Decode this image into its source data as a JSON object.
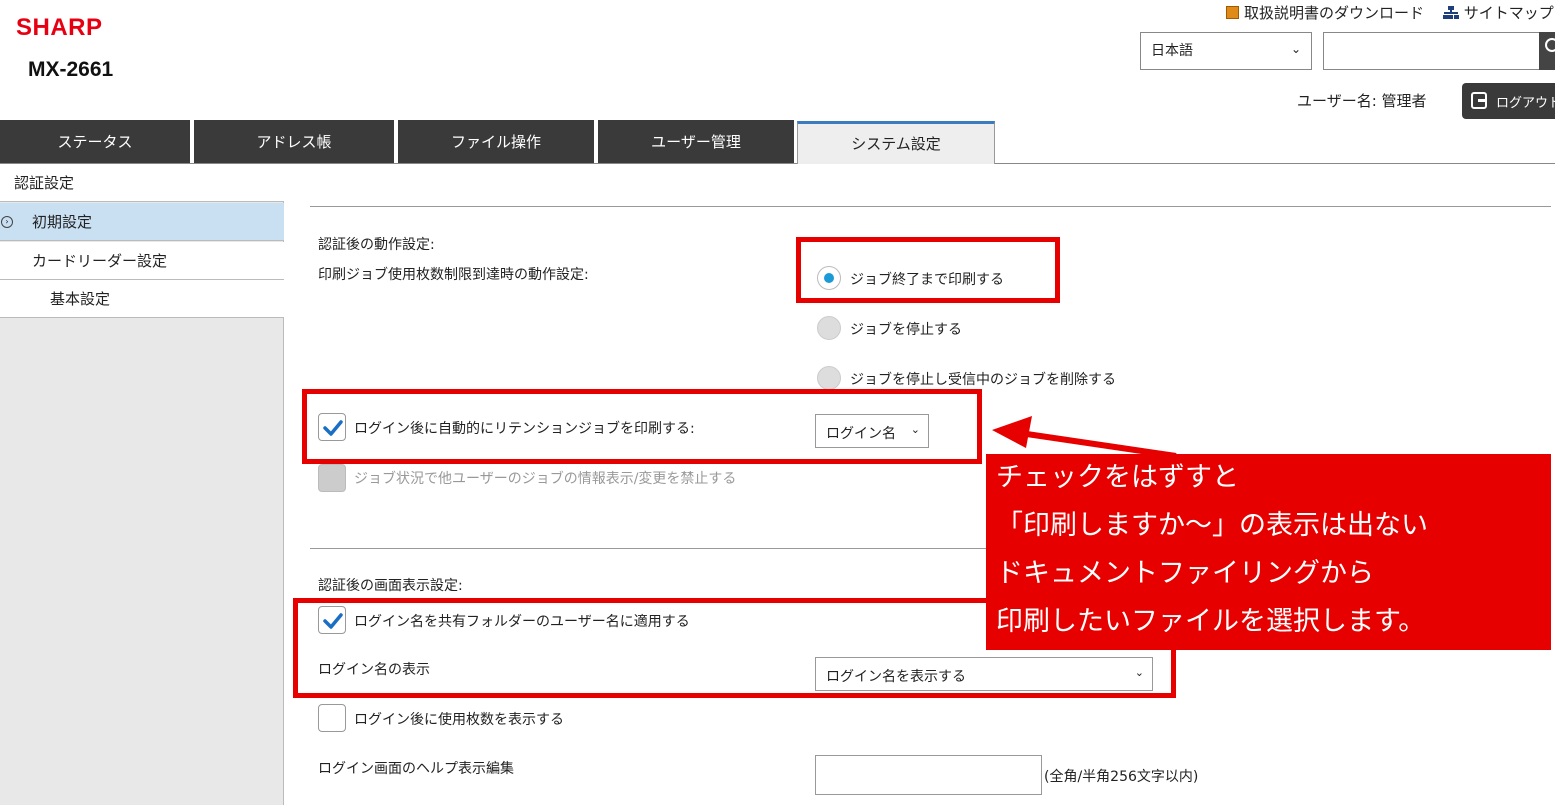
{
  "header": {
    "brand": "SHARP",
    "model": "MX-2661",
    "manual_link": "取扱説明書のダウンロード",
    "sitemap_link": "サイトマップ",
    "language": "日本語",
    "search_placeholder": "",
    "user_label": "ユーザー名: 管理者",
    "logout_label": "ログアウト"
  },
  "tabs": [
    {
      "label": "ステータス"
    },
    {
      "label": "アドレス帳"
    },
    {
      "label": "ファイル操作"
    },
    {
      "label": "ユーザー管理"
    },
    {
      "label": "システム設定"
    }
  ],
  "sidebar": {
    "items": [
      {
        "label": "認証設定"
      },
      {
        "label": "初期設定"
      },
      {
        "label": "カードリーダー設定"
      },
      {
        "label": "基本設定"
      }
    ]
  },
  "main": {
    "after_auth_title": "認証後の動作設定:",
    "print_limit_label": "印刷ジョブ使用枚数制限到達時の動作設定:",
    "radio_options": [
      {
        "label": "ジョブ終了まで印刷する",
        "checked": true
      },
      {
        "label": "ジョブを停止する",
        "checked": false
      },
      {
        "label": "ジョブを停止し受信中のジョブを削除する",
        "checked": false
      }
    ],
    "auto_retention_label": "ログイン後に自動的にリテンションジョブを印刷する:",
    "auto_retention_checked": true,
    "auto_retention_select": "ログイン名",
    "prohibit_label": "ジョブ状況で他ユーザーのジョブの情報表示/変更を禁止する",
    "screen_display_title": "認証後の画面表示設定:",
    "apply_login_name_label": "ログイン名を共有フォルダーのユーザー名に適用する",
    "apply_login_name_checked": true,
    "login_name_display_label": "ログイン名の表示",
    "login_name_display_select": "ログイン名を表示する",
    "show_usage_label": "ログイン後に使用枚数を表示する",
    "show_usage_checked": false,
    "help_edit_label": "ログイン画面のヘルプ表示編集",
    "help_edit_value": "",
    "help_edit_note": "(全角/半角256文字以内)"
  },
  "callout": {
    "lines": [
      "チェックをはずすと",
      "「印刷しますか～」の表示は出ない",
      "ドキュメントファイリングから",
      "印刷したいファイルを選択します。"
    ]
  },
  "colors": {
    "brand_red": "#e60012",
    "annotation_red": "#e60000",
    "tab_dark": "#3a3a3a",
    "tab_active_accent": "#3d7bbf",
    "sidebar_selected": "#c9dff2",
    "radio_selected": "#1a9ad6",
    "check_mark": "#1a6fc4"
  }
}
